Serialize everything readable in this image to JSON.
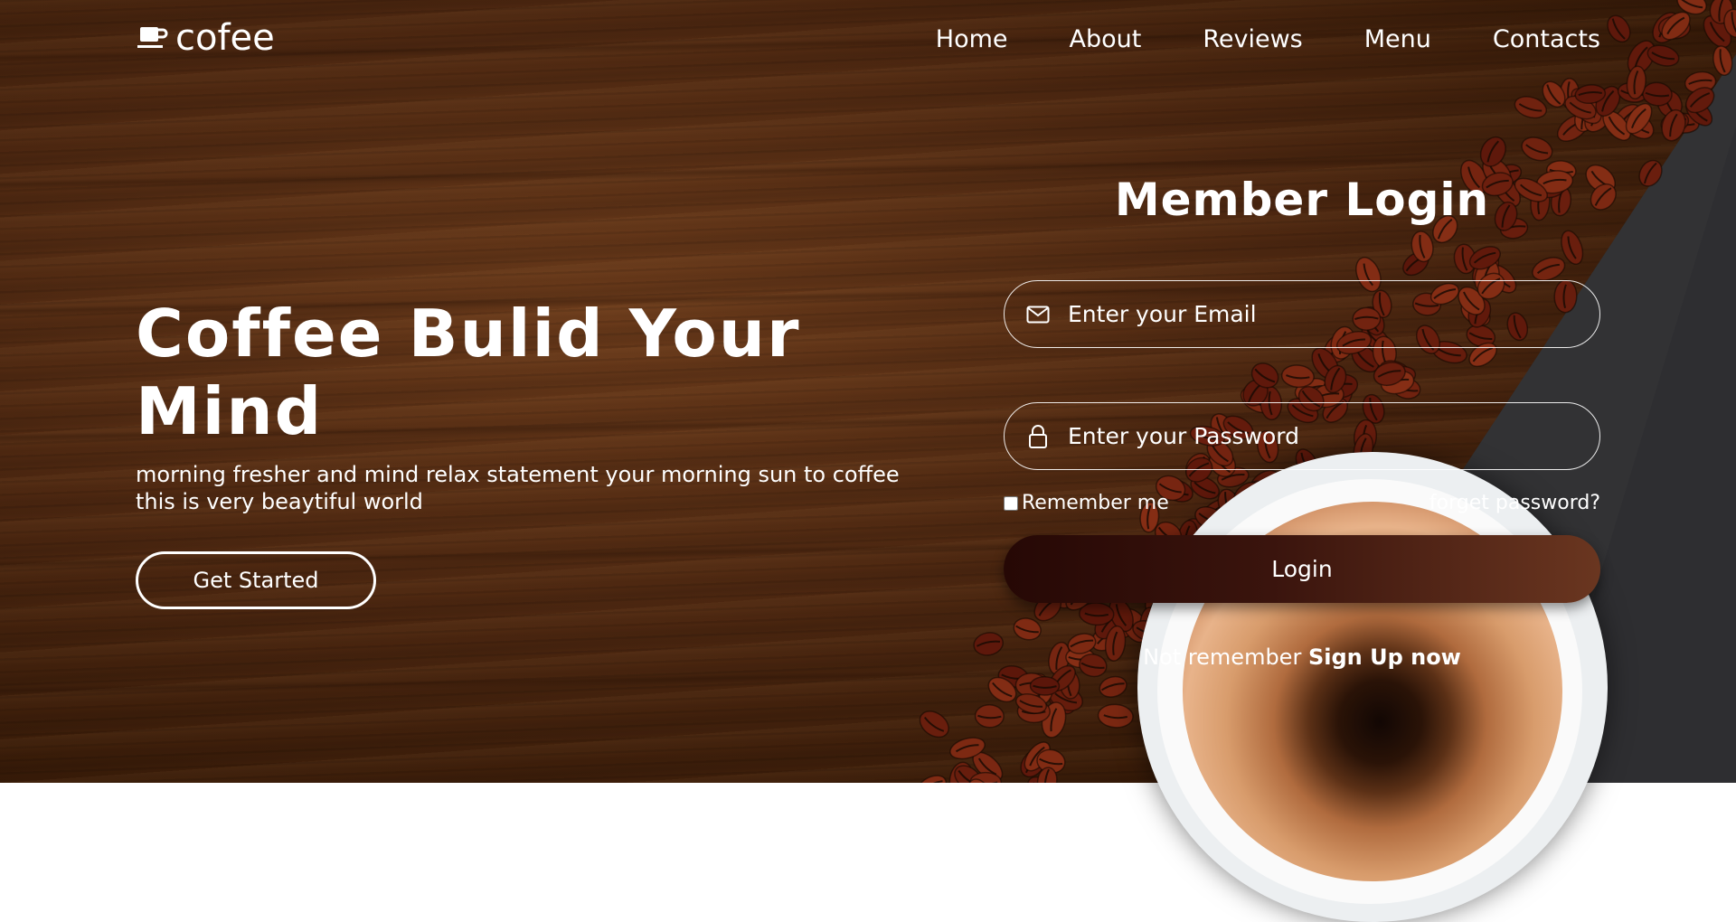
{
  "brand": {
    "logo_text": "cofee",
    "logo_icon": "coffee-cup-icon"
  },
  "nav": {
    "items": [
      "Home",
      "About",
      "Reviews",
      "Menu",
      "Contacts"
    ]
  },
  "hero": {
    "title": "Coffee Bulid Your Mind",
    "subtitle": "morning fresher and mind relax statement your morning sun to coffee this is very beaytiful world",
    "cta_label": "Get Started"
  },
  "login": {
    "title": "Member Login",
    "email_placeholder": "Enter your Email",
    "email_icon": "envelope-icon",
    "password_placeholder": "Enter your Password",
    "password_icon": "lock-icon",
    "remember_label": "Remember me",
    "remember_checked": false,
    "forgot_label": "forget password?",
    "submit_label": "Login",
    "signup_prefix": "Not remember",
    "signup_link": "Sign Up now"
  },
  "colors": {
    "text": "#ffffff",
    "wood": "#4d2710",
    "button_start": "#260805",
    "button_end": "#6a3620",
    "slate": "#2e2e31"
  }
}
